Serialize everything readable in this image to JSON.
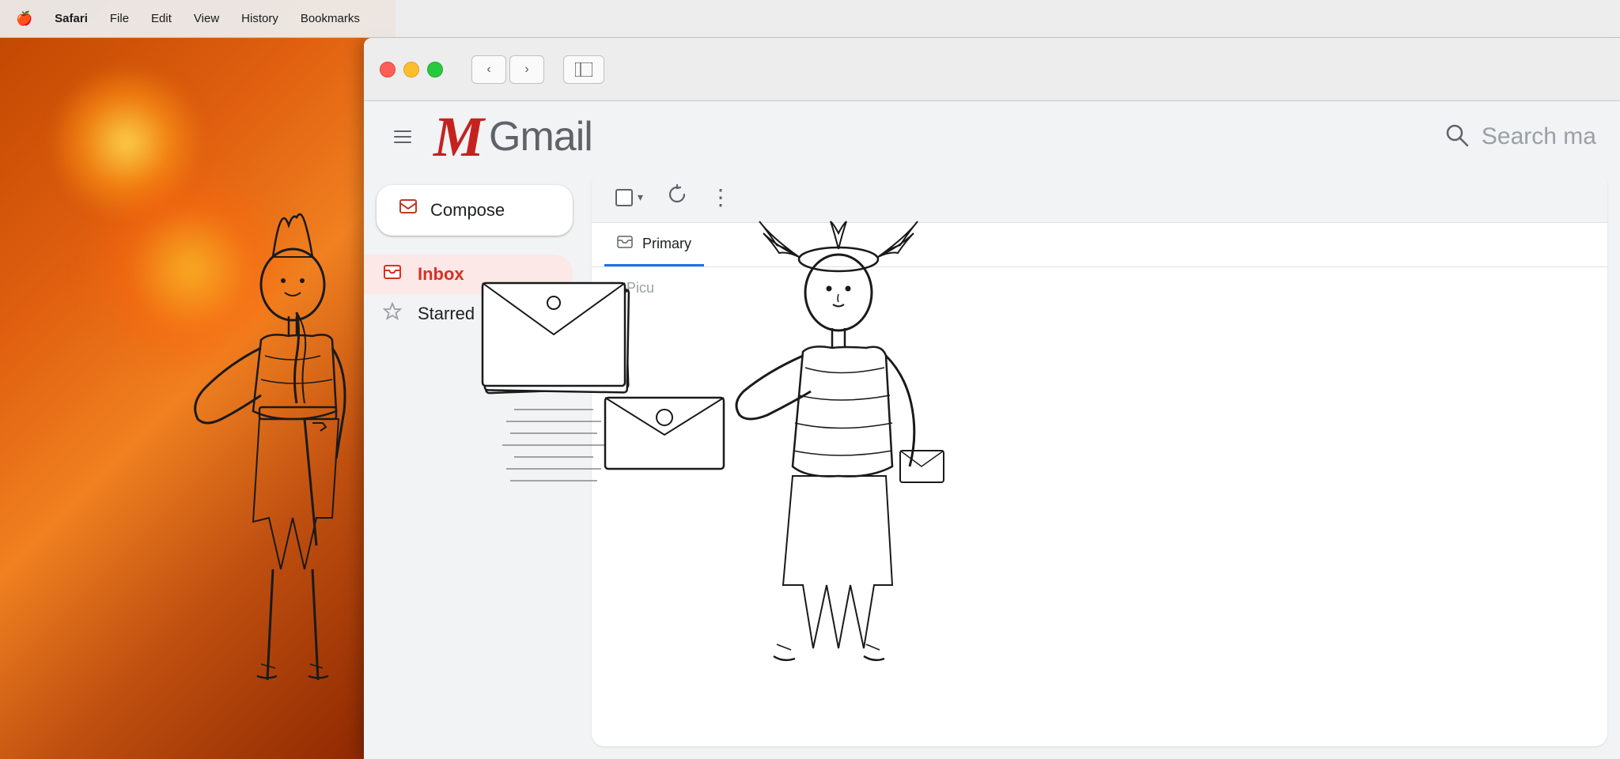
{
  "menubar": {
    "apple": "🍎",
    "items": [
      "Safari",
      "File",
      "Edit",
      "View",
      "History",
      "Bookmarks"
    ]
  },
  "browser": {
    "back_label": "‹",
    "forward_label": "›",
    "sidebar_label": "⊡"
  },
  "gmail": {
    "hamburger_lines": 3,
    "logo_m": "M",
    "logo_text": "Gmail",
    "search_placeholder": "Search ma",
    "compose_label": "Compose",
    "toolbar": {
      "checkbox_label": "",
      "dropdown_arrow": "▾",
      "refresh_label": "↺",
      "more_label": "⋮"
    },
    "sidebar_items": [
      {
        "id": "inbox",
        "label": "Inbox",
        "icon": "inbox",
        "active": true
      },
      {
        "id": "starred",
        "label": "Starred",
        "icon": "star",
        "active": false
      }
    ],
    "primary_tab": {
      "icon": "inbox",
      "label": "Primary"
    },
    "picu_label": "Picu"
  },
  "colors": {
    "gmail_red": "#c5221f",
    "active_item_bg": "#fce8e6",
    "active_label": "#d93025",
    "tab_underline": "#1a73e8",
    "text_primary": "#202124",
    "text_secondary": "#5f6368",
    "search_placeholder": "#9aa0a6"
  }
}
